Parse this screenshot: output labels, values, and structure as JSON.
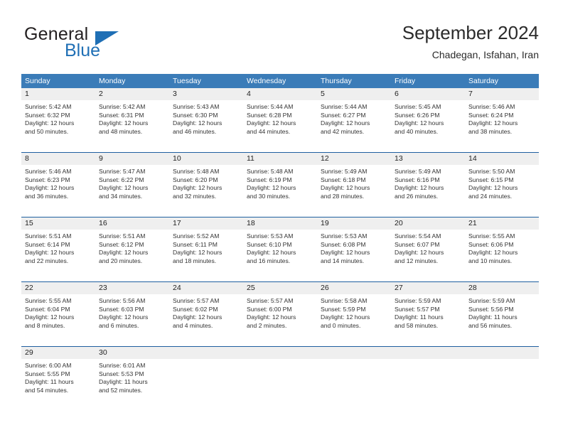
{
  "brand": {
    "word_one": "General",
    "word_two": "Blue",
    "logo_icon": "triangle-icon"
  },
  "header": {
    "title": "September 2024",
    "subtitle": "Chadegan, Isfahan, Iran"
  },
  "colors": {
    "header_blue": "#3b7cb8",
    "separator_blue": "#1f5fa0",
    "daynum_band": "#efefef",
    "brand_blue": "#1f6fb5"
  },
  "weekdays": [
    "Sunday",
    "Monday",
    "Tuesday",
    "Wednesday",
    "Thursday",
    "Friday",
    "Saturday"
  ],
  "labels": {
    "sunrise_prefix": "Sunrise:",
    "sunset_prefix": "Sunset:",
    "daylight_prefix": "Daylight:"
  },
  "weeks": [
    [
      {
        "day": "1",
        "sunrise": "Sunrise: 5:42 AM",
        "sunset": "Sunset: 6:32 PM",
        "daylight_1": "Daylight: 12 hours",
        "daylight_2": "and 50 minutes."
      },
      {
        "day": "2",
        "sunrise": "Sunrise: 5:42 AM",
        "sunset": "Sunset: 6:31 PM",
        "daylight_1": "Daylight: 12 hours",
        "daylight_2": "and 48 minutes."
      },
      {
        "day": "3",
        "sunrise": "Sunrise: 5:43 AM",
        "sunset": "Sunset: 6:30 PM",
        "daylight_1": "Daylight: 12 hours",
        "daylight_2": "and 46 minutes."
      },
      {
        "day": "4",
        "sunrise": "Sunrise: 5:44 AM",
        "sunset": "Sunset: 6:28 PM",
        "daylight_1": "Daylight: 12 hours",
        "daylight_2": "and 44 minutes."
      },
      {
        "day": "5",
        "sunrise": "Sunrise: 5:44 AM",
        "sunset": "Sunset: 6:27 PM",
        "daylight_1": "Daylight: 12 hours",
        "daylight_2": "and 42 minutes."
      },
      {
        "day": "6",
        "sunrise": "Sunrise: 5:45 AM",
        "sunset": "Sunset: 6:26 PM",
        "daylight_1": "Daylight: 12 hours",
        "daylight_2": "and 40 minutes."
      },
      {
        "day": "7",
        "sunrise": "Sunrise: 5:46 AM",
        "sunset": "Sunset: 6:24 PM",
        "daylight_1": "Daylight: 12 hours",
        "daylight_2": "and 38 minutes."
      }
    ],
    [
      {
        "day": "8",
        "sunrise": "Sunrise: 5:46 AM",
        "sunset": "Sunset: 6:23 PM",
        "daylight_1": "Daylight: 12 hours",
        "daylight_2": "and 36 minutes."
      },
      {
        "day": "9",
        "sunrise": "Sunrise: 5:47 AM",
        "sunset": "Sunset: 6:22 PM",
        "daylight_1": "Daylight: 12 hours",
        "daylight_2": "and 34 minutes."
      },
      {
        "day": "10",
        "sunrise": "Sunrise: 5:48 AM",
        "sunset": "Sunset: 6:20 PM",
        "daylight_1": "Daylight: 12 hours",
        "daylight_2": "and 32 minutes."
      },
      {
        "day": "11",
        "sunrise": "Sunrise: 5:48 AM",
        "sunset": "Sunset: 6:19 PM",
        "daylight_1": "Daylight: 12 hours",
        "daylight_2": "and 30 minutes."
      },
      {
        "day": "12",
        "sunrise": "Sunrise: 5:49 AM",
        "sunset": "Sunset: 6:18 PM",
        "daylight_1": "Daylight: 12 hours",
        "daylight_2": "and 28 minutes."
      },
      {
        "day": "13",
        "sunrise": "Sunrise: 5:49 AM",
        "sunset": "Sunset: 6:16 PM",
        "daylight_1": "Daylight: 12 hours",
        "daylight_2": "and 26 minutes."
      },
      {
        "day": "14",
        "sunrise": "Sunrise: 5:50 AM",
        "sunset": "Sunset: 6:15 PM",
        "daylight_1": "Daylight: 12 hours",
        "daylight_2": "and 24 minutes."
      }
    ],
    [
      {
        "day": "15",
        "sunrise": "Sunrise: 5:51 AM",
        "sunset": "Sunset: 6:14 PM",
        "daylight_1": "Daylight: 12 hours",
        "daylight_2": "and 22 minutes."
      },
      {
        "day": "16",
        "sunrise": "Sunrise: 5:51 AM",
        "sunset": "Sunset: 6:12 PM",
        "daylight_1": "Daylight: 12 hours",
        "daylight_2": "and 20 minutes."
      },
      {
        "day": "17",
        "sunrise": "Sunrise: 5:52 AM",
        "sunset": "Sunset: 6:11 PM",
        "daylight_1": "Daylight: 12 hours",
        "daylight_2": "and 18 minutes."
      },
      {
        "day": "18",
        "sunrise": "Sunrise: 5:53 AM",
        "sunset": "Sunset: 6:10 PM",
        "daylight_1": "Daylight: 12 hours",
        "daylight_2": "and 16 minutes."
      },
      {
        "day": "19",
        "sunrise": "Sunrise: 5:53 AM",
        "sunset": "Sunset: 6:08 PM",
        "daylight_1": "Daylight: 12 hours",
        "daylight_2": "and 14 minutes."
      },
      {
        "day": "20",
        "sunrise": "Sunrise: 5:54 AM",
        "sunset": "Sunset: 6:07 PM",
        "daylight_1": "Daylight: 12 hours",
        "daylight_2": "and 12 minutes."
      },
      {
        "day": "21",
        "sunrise": "Sunrise: 5:55 AM",
        "sunset": "Sunset: 6:06 PM",
        "daylight_1": "Daylight: 12 hours",
        "daylight_2": "and 10 minutes."
      }
    ],
    [
      {
        "day": "22",
        "sunrise": "Sunrise: 5:55 AM",
        "sunset": "Sunset: 6:04 PM",
        "daylight_1": "Daylight: 12 hours",
        "daylight_2": "and 8 minutes."
      },
      {
        "day": "23",
        "sunrise": "Sunrise: 5:56 AM",
        "sunset": "Sunset: 6:03 PM",
        "daylight_1": "Daylight: 12 hours",
        "daylight_2": "and 6 minutes."
      },
      {
        "day": "24",
        "sunrise": "Sunrise: 5:57 AM",
        "sunset": "Sunset: 6:02 PM",
        "daylight_1": "Daylight: 12 hours",
        "daylight_2": "and 4 minutes."
      },
      {
        "day": "25",
        "sunrise": "Sunrise: 5:57 AM",
        "sunset": "Sunset: 6:00 PM",
        "daylight_1": "Daylight: 12 hours",
        "daylight_2": "and 2 minutes."
      },
      {
        "day": "26",
        "sunrise": "Sunrise: 5:58 AM",
        "sunset": "Sunset: 5:59 PM",
        "daylight_1": "Daylight: 12 hours",
        "daylight_2": "and 0 minutes."
      },
      {
        "day": "27",
        "sunrise": "Sunrise: 5:59 AM",
        "sunset": "Sunset: 5:57 PM",
        "daylight_1": "Daylight: 11 hours",
        "daylight_2": "and 58 minutes."
      },
      {
        "day": "28",
        "sunrise": "Sunrise: 5:59 AM",
        "sunset": "Sunset: 5:56 PM",
        "daylight_1": "Daylight: 11 hours",
        "daylight_2": "and 56 minutes."
      }
    ],
    [
      {
        "day": "29",
        "sunrise": "Sunrise: 6:00 AM",
        "sunset": "Sunset: 5:55 PM",
        "daylight_1": "Daylight: 11 hours",
        "daylight_2": "and 54 minutes."
      },
      {
        "day": "30",
        "sunrise": "Sunrise: 6:01 AM",
        "sunset": "Sunset: 5:53 PM",
        "daylight_1": "Daylight: 11 hours",
        "daylight_2": "and 52 minutes."
      },
      {
        "day": "",
        "sunrise": "",
        "sunset": "",
        "daylight_1": "",
        "daylight_2": ""
      },
      {
        "day": "",
        "sunrise": "",
        "sunset": "",
        "daylight_1": "",
        "daylight_2": ""
      },
      {
        "day": "",
        "sunrise": "",
        "sunset": "",
        "daylight_1": "",
        "daylight_2": ""
      },
      {
        "day": "",
        "sunrise": "",
        "sunset": "",
        "daylight_1": "",
        "daylight_2": ""
      },
      {
        "day": "",
        "sunrise": "",
        "sunset": "",
        "daylight_1": "",
        "daylight_2": ""
      }
    ]
  ]
}
